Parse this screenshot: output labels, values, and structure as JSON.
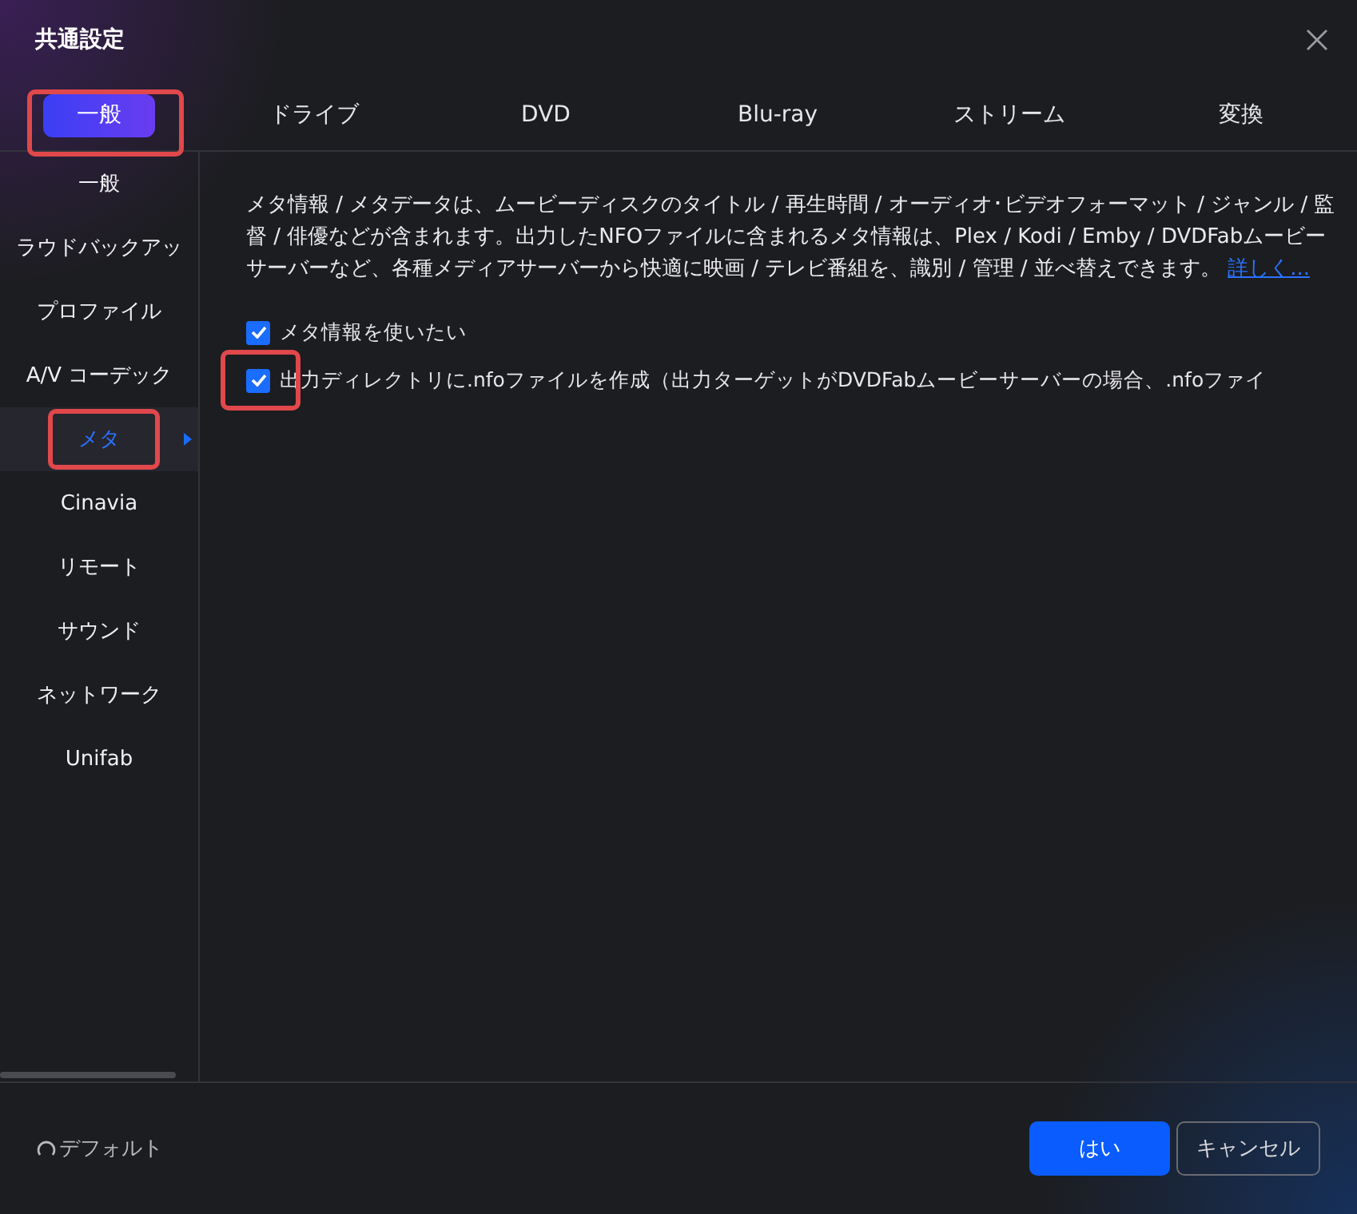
{
  "window": {
    "title": "共通設定"
  },
  "tabs": [
    {
      "label": "一般",
      "selected": true
    },
    {
      "label": "ドライブ",
      "selected": false
    },
    {
      "label": "DVD",
      "selected": false
    },
    {
      "label": "Blu-ray",
      "selected": false
    },
    {
      "label": "ストリーム",
      "selected": false
    },
    {
      "label": "変換",
      "selected": false
    }
  ],
  "sidebar": {
    "items": [
      {
        "label": "一般",
        "selected": false
      },
      {
        "label": "ラウドバックアッ",
        "selected": false
      },
      {
        "label": "プロファイル",
        "selected": false
      },
      {
        "label": "A/V コーデック",
        "selected": false
      },
      {
        "label": "メタ",
        "selected": true
      },
      {
        "label": "Cinavia",
        "selected": false
      },
      {
        "label": "リモート",
        "selected": false
      },
      {
        "label": "サウンド",
        "selected": false
      },
      {
        "label": "ネットワーク",
        "selected": false
      },
      {
        "label": "Unifab",
        "selected": false
      }
    ]
  },
  "content": {
    "description": "メタ情報 / メタデータは、ムービーディスクのタイトル / 再生時間 / オーディオ･ビデオフォーマット / ジャンル / 監督 / 俳優などが含まれます。出力したNFOファイルに含まれるメタ情報は、Plex / Kodi / Emby / DVDFabムービーサーバーなど、各種メディアサーバーから快適に映画 / テレビ番組を、識別 / 管理 / 並べ替えできます。",
    "link": "詳しく...",
    "options": [
      {
        "label": "メタ情報を使いたい",
        "checked": true
      },
      {
        "label": "出力ディレクトリに.nfoファイルを作成（出力ターゲットがDVDFabムービーサーバーの場合、.nfoファイ",
        "checked": true
      }
    ]
  },
  "footer": {
    "default_label": "デフォルト",
    "buttons": [
      {
        "label": "はい",
        "kind": "primary"
      },
      {
        "label": "キャンセル",
        "kind": "secondary"
      }
    ]
  }
}
